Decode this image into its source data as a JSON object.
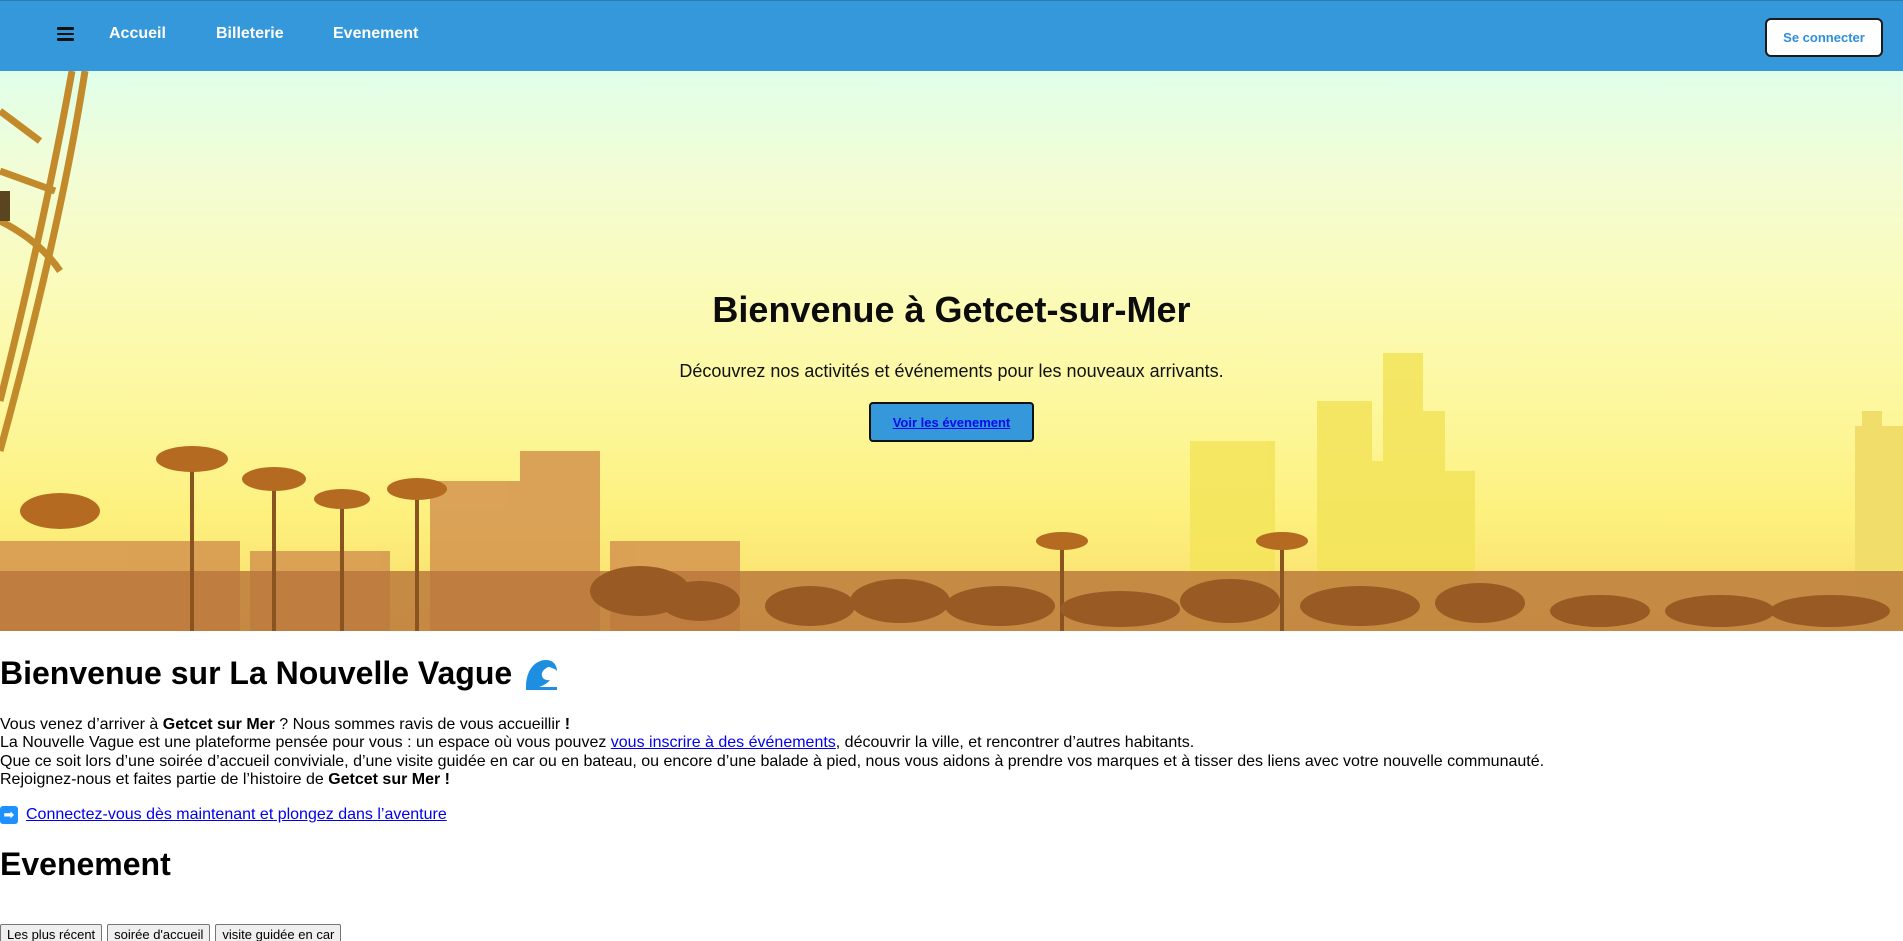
{
  "nav": {
    "links": [
      "Accueil",
      "Billeterie",
      "Evenement"
    ],
    "login_label": "Se connecter",
    "accent_color": "#3498db"
  },
  "hero": {
    "title": "Bienvenue à Getcet-sur-Mer",
    "subtitle": "Découvrez nos activités et événements pour les nouveaux arrivants.",
    "cta_label": "Voir les évenement"
  },
  "intro": {
    "title": "Bienvenue sur La Nouvelle Vague",
    "title_icon": "wave-icon",
    "line1_a": "Vous venez d’arriver à ",
    "line1_b": "Getcet sur Mer",
    "line1_c": " ? Nous sommes ravis de vous accueillir ",
    "line1_d": "!",
    "line2_a": "La Nouvelle Vague est une plateforme pensée pour vous : un espace où vous pouvez ",
    "line2_link": "vous inscrire à des événements",
    "line2_c": ", découvrir la ville, et rencontrer d’autres habitants.",
    "line3": "Que ce soit lors d’une soirée d’accueil conviviale, d’une visite guidée en car ou en bateau, ou encore d’une balade à pied, nous vous aidons à prendre vos marques et à tisser des liens avec votre nouvelle communauté.",
    "line4_a": "Rejoignez-nous et faites partie de l’histoire de ",
    "line4_b": "Getcet sur Mer",
    "line4_c": " !",
    "cta_icon": "arrow-right-icon",
    "cta_link": "Connectez-vous dès maintenant et plongez dans l’aventure"
  },
  "events": {
    "title": "Evenement",
    "filters": [
      "Les plus récent",
      "soirée d'accueil",
      "visite guidée en car"
    ]
  }
}
